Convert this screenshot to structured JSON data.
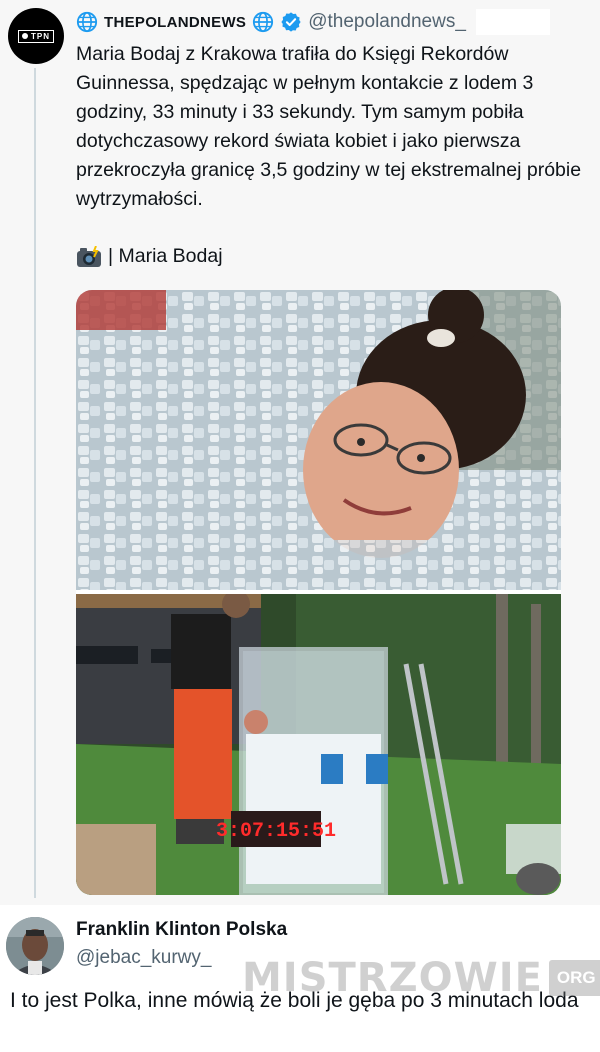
{
  "post": {
    "author_name": "THEPOLANDNEWS",
    "author_handle": "@thepolandnews_",
    "avatar_label": "TPN",
    "text": "Maria Bodaj z Krakowa trafiła do Księgi Rekordów Guinnessa, spędzając w pełnym kontakcie z lodem 3 godziny, 33 minuty i 33 sekundy. Tym samym pobiła dotychczasowy rekord świata kobiet i jako pierwsza przekroczyła granicę 3,5 godziny w tej ekstremalnej próbie wytrzymałości.",
    "photo_credit": "| Maria Bodaj",
    "icons": [
      "globe-icon",
      "verified-badge-icon",
      "camera-flash-icon"
    ],
    "timer_display": "3:07:15:51"
  },
  "reply": {
    "author_name": "Franklin Klinton Polska",
    "author_handle": "@jebac_kurwy_",
    "text": "I to jest Polka, inne mówią że boli je gęba po 3 minutach loda"
  },
  "watermark": {
    "text": "MISTRZOWIE",
    "badge": "ORG"
  },
  "colors": {
    "verified": "#1d9bf0",
    "handle": "#536471",
    "thread_line": "#cfd9de"
  }
}
